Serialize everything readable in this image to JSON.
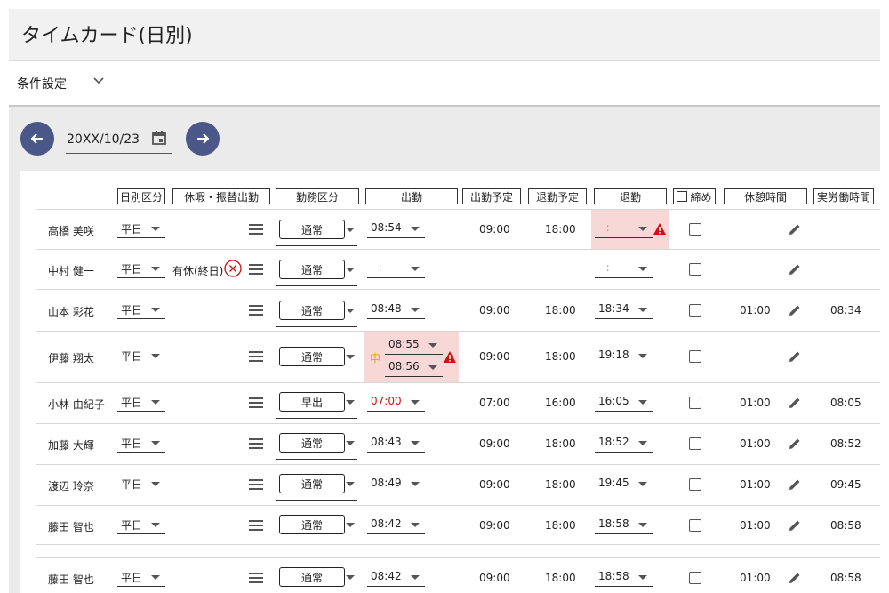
{
  "page": {
    "title": "タイムカード(日別)"
  },
  "conditions": {
    "label": "条件設定",
    "toggle_icon": "chevron-down-icon"
  },
  "date_nav": {
    "date": "20XX/10/23",
    "prev_icon": "arrow-left-icon",
    "next_icon": "arrow-right-icon",
    "calendar_icon": "calendar-icon"
  },
  "headers": {
    "day_type": "日別区分",
    "leave": "休暇・振替出勤",
    "work_type": "勤務区分",
    "clock_in": "出勤",
    "planned_in": "出勤予定",
    "planned_out": "退勤予定",
    "clock_out": "退勤",
    "closing": "締め",
    "break": "休憩時間",
    "actual": "実労働時間"
  },
  "colors": {
    "accent": "#4a5788",
    "error_bg": "#f8d7d7",
    "error": "#d01010",
    "request": "#f0a000"
  },
  "rows": [
    {
      "name": "高橋 美咲",
      "day_type": "平日",
      "leave": "",
      "work_type": "通常",
      "clock_in": "08:54",
      "planned_in": "09:00",
      "planned_out": "18:00",
      "clock_out": "--:--",
      "break": "",
      "actual": ""
    },
    {
      "name": "中村 健一",
      "day_type": "平日",
      "leave": "有休(終日)",
      "work_type": "通常",
      "clock_in": "--:--",
      "planned_in": "",
      "planned_out": "",
      "clock_out": "--:--",
      "break": "",
      "actual": ""
    },
    {
      "name": "山本 彩花",
      "day_type": "平日",
      "leave": "",
      "work_type": "通常",
      "clock_in": "08:48",
      "planned_in": "09:00",
      "planned_out": "18:00",
      "clock_out": "18:34",
      "break": "01:00",
      "actual": "08:34"
    },
    {
      "name": "伊藤 翔太",
      "day_type": "平日",
      "leave": "",
      "work_type": "通常",
      "clock_in": "08:55",
      "clock_in_request": "08:56",
      "request_mark": "申",
      "planned_in": "09:00",
      "planned_out": "18:00",
      "clock_out": "19:18",
      "break": "",
      "actual": ""
    },
    {
      "name": "小林 由紀子",
      "day_type": "平日",
      "leave": "",
      "work_type": "早出",
      "clock_in": "07:00",
      "planned_in": "07:00",
      "planned_out": "16:00",
      "clock_out": "16:05",
      "break": "01:00",
      "actual": "08:05"
    },
    {
      "name": "加藤 大輝",
      "day_type": "平日",
      "leave": "",
      "work_type": "通常",
      "clock_in": "08:43",
      "planned_in": "09:00",
      "planned_out": "18:00",
      "clock_out": "18:52",
      "break": "01:00",
      "actual": "08:52"
    },
    {
      "name": "渡辺 玲奈",
      "day_type": "平日",
      "leave": "",
      "work_type": "通常",
      "clock_in": "08:49",
      "planned_in": "09:00",
      "planned_out": "18:00",
      "clock_out": "19:45",
      "break": "01:00",
      "actual": "09:45"
    },
    {
      "name": "藤田 智也",
      "day_type": "平日",
      "leave": "",
      "work_type": "通常",
      "clock_in": "08:42",
      "planned_in": "09:00",
      "planned_out": "18:00",
      "clock_out": "18:58",
      "break": "01:00",
      "actual": "08:58"
    },
    {
      "name": "藤田 智也",
      "day_type": "平日",
      "leave": "",
      "work_type": "通常",
      "clock_in": "08:42",
      "planned_in": "09:00",
      "planned_out": "18:00",
      "clock_out": "18:58",
      "break": "01:00",
      "actual": "08:58"
    }
  ]
}
